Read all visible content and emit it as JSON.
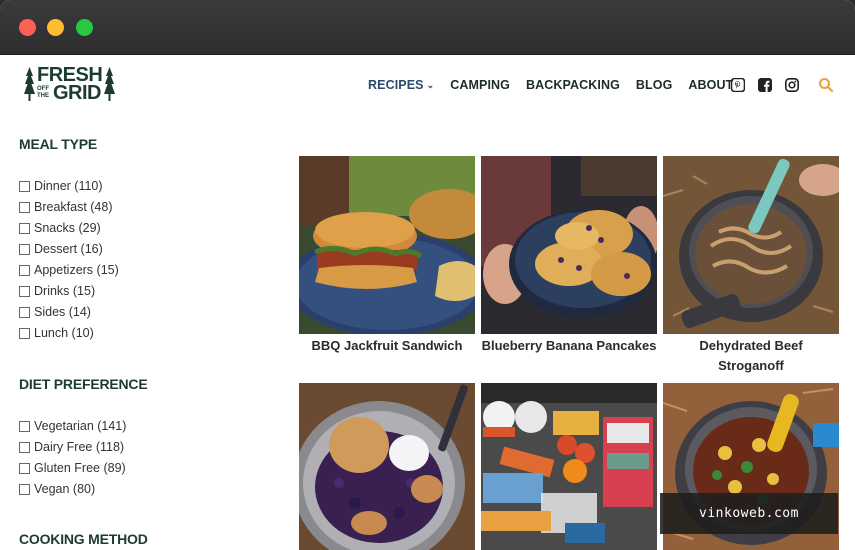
{
  "window": {
    "controls": [
      "close",
      "minimize",
      "maximize"
    ]
  },
  "logo": {
    "line1": "FRESH",
    "line2": "OFF THE",
    "line3": "GRID"
  },
  "nav": {
    "items": [
      "RECIPES",
      "CAMPING",
      "BACKPACKING",
      "BLOG",
      "ABOUT"
    ],
    "active": "RECIPES",
    "dropdown_marker": "⌄",
    "social_icons": [
      "pinterest-icon",
      "facebook-icon",
      "instagram-icon"
    ],
    "search_icon": "search-icon"
  },
  "filters": [
    {
      "heading": "MEAL TYPE",
      "options": [
        "Dinner (110)",
        "Breakfast (48)",
        "Snacks (29)",
        "Dessert (16)",
        "Appetizers (15)",
        "Drinks (15)",
        "Sides (14)",
        "Lunch (10)"
      ]
    },
    {
      "heading": "DIET PREFERENCE",
      "options": [
        "Vegetarian (141)",
        "Dairy Free (118)",
        "Gluten Free (89)",
        "Vegan (80)"
      ]
    },
    {
      "heading": "COOKING METHOD",
      "options": []
    }
  ],
  "recipes": [
    {
      "title_lines": [
        "BBQ Jackfruit Sandwich"
      ]
    },
    {
      "title_lines": [
        "Blueberry Banana Pancakes"
      ]
    },
    {
      "title_lines": [
        "Dehydrated Beef",
        "Stroganoff"
      ]
    },
    {
      "title_lines": []
    },
    {
      "title_lines": []
    },
    {
      "title_lines": []
    }
  ],
  "watermark": "vinkoweb.com",
  "colors": {
    "brand": "#1d3b33",
    "nav_active": "#2a4a6b",
    "search": "#e8a23a"
  }
}
